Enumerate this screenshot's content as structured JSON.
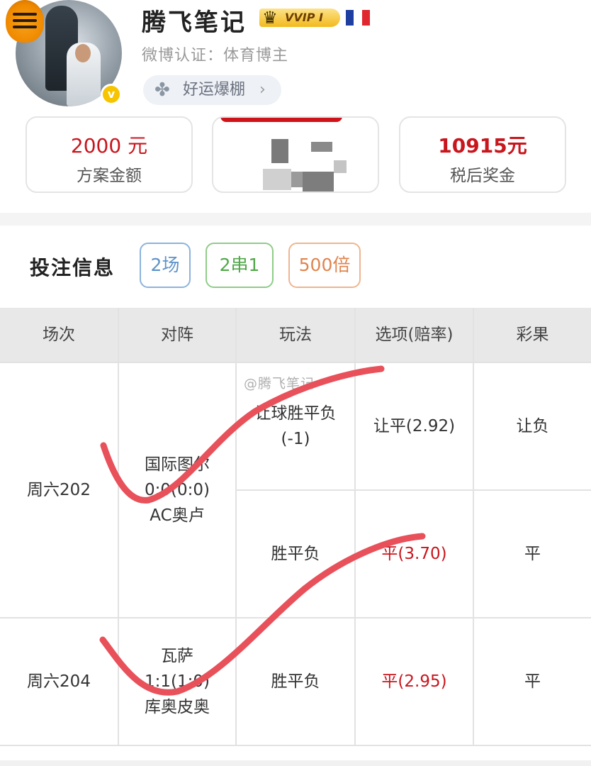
{
  "profile": {
    "name": "腾飞笔记",
    "vip_label": "VVIP Ⅰ",
    "certification": "微博认证：体育博主",
    "luck_label": "好运爆棚",
    "luck_chevron": "›",
    "verify_mark": "v",
    "flag_colors": [
      "#1f3fa0",
      "#ffffff",
      "#e0262e"
    ]
  },
  "stats": {
    "amount_value": "2000 元",
    "amount_label": "方案金额",
    "prize_value": "10915元",
    "prize_label": "税后奖金"
  },
  "bet_info": {
    "title": "投注信息",
    "tags": [
      "2场",
      "2串1",
      "500倍"
    ]
  },
  "table": {
    "headers": [
      "场次",
      "对阵",
      "玩法",
      "选项(赔率)",
      "彩果"
    ],
    "matches": [
      {
        "id": "周六202",
        "teams": [
          "国际图尔",
          "0:0(0:0)",
          "AC奥卢"
        ],
        "plays": [
          {
            "type": [
              "让球胜平负",
              "(-1)"
            ],
            "option": "让平(2.92)",
            "option_color": "#333333",
            "result": "让负"
          },
          {
            "type": [
              "胜平负"
            ],
            "option": "平(3.70)",
            "option_color": "#c8161d",
            "result": "平"
          }
        ]
      },
      {
        "id": "周六204",
        "teams": [
          "瓦萨",
          "1:1(1:0)",
          "库奥皮奥"
        ],
        "plays": [
          {
            "type": [
              "胜平负"
            ],
            "option": "平(2.95)",
            "option_color": "#c8161d",
            "result": "平"
          }
        ]
      }
    ]
  },
  "watermark": "@腾飞笔记",
  "colors": {
    "accent_red": "#c8161d",
    "stroke_red": "#e8505a",
    "header_bg": "#e8e8e8"
  }
}
